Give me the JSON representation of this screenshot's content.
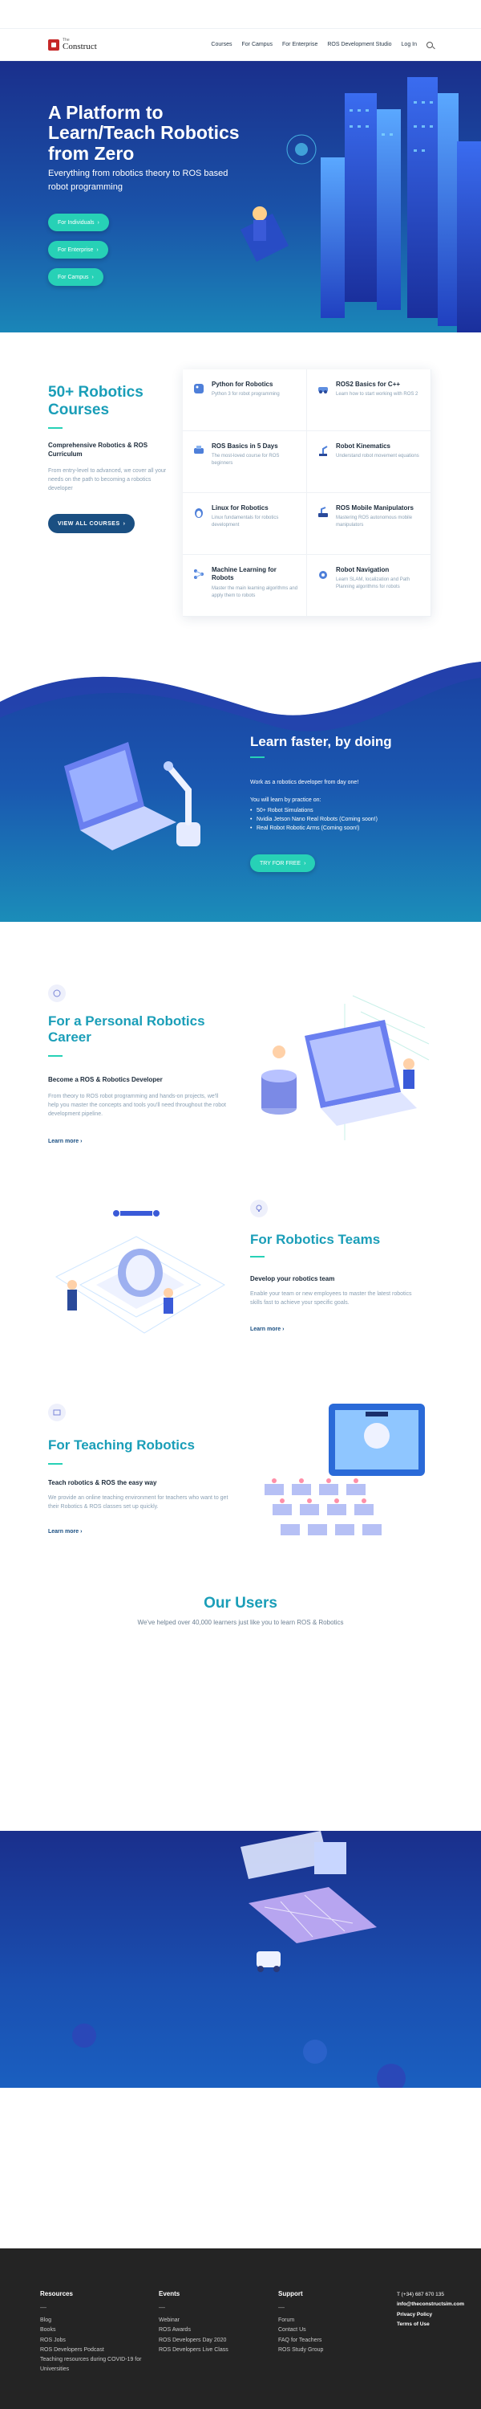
{
  "header": {
    "logo_small": "The",
    "logo_big": "Construct",
    "nav": [
      "Courses",
      "For Campus",
      "For Enterprise",
      "ROS Development Studio",
      "Log In"
    ]
  },
  "hero": {
    "title": "A Platform to Learn/Teach Robotics from Zero",
    "subtitle": "Everything from robotics theory to ROS based robot programming",
    "buttons": [
      "For Individuals",
      "For Enterprise",
      "For Campus"
    ]
  },
  "courses": {
    "title": "50+ Robotics Courses",
    "subtitle": "Comprehensive Robotics & ROS Curriculum",
    "description": "From entry-level to advanced, we cover all your needs on the path to becoming a robotics developer",
    "button": "VIEW ALL COURSES",
    "items": [
      {
        "name": "Python for Robotics",
        "desc": "Python 3 for robot programming"
      },
      {
        "name": "ROS2 Basics for C++",
        "desc": "Learn how to start working with ROS 2"
      },
      {
        "name": "ROS Basics in 5 Days",
        "desc": "The most-loved course for ROS beginners"
      },
      {
        "name": "Robot Kinematics",
        "desc": "Understand robot movement equations"
      },
      {
        "name": "Linux for Robotics",
        "desc": "Linux fundamentals for robotics development"
      },
      {
        "name": "ROS Mobile Manipulators",
        "desc": "Mastering ROS autonomous mobile manipulators"
      },
      {
        "name": "Machine Learning for Robots",
        "desc": "Master the main learning algorithms and apply them to robots"
      },
      {
        "name": "Robot Navigation",
        "desc": "Learn SLAM, localization and Path Planning algorithms for robots"
      }
    ]
  },
  "learn": {
    "title": "Learn faster, by doing",
    "line1": "Work as a robotics developer from day one!",
    "line2": "You will learn by practice on:",
    "bullets": [
      "50+ Robot Simulations",
      "Nvidia Jetson Nano Real Robots (Coming soon!)",
      "Real Robot Robotic Arms (Coming soon!)"
    ],
    "button": "TRY FOR FREE"
  },
  "personal": {
    "title": "For a Personal Robotics Career",
    "subtitle": "Become a ROS & Robotics Developer",
    "description": "From theory to ROS robot programming and hands-on projects, we'll help you master the concepts and tools you'll need throughout the robot development pipeline.",
    "link": "Learn more"
  },
  "teams": {
    "title": "For Robotics Teams",
    "subtitle": "Develop your robotics team",
    "description": "Enable your team or new employees to master the latest robotics skills fast to achieve your specific goals.",
    "link": "Learn more"
  },
  "teaching": {
    "title": "For Teaching Robotics",
    "subtitle": "Teach robotics & ROS the easy way",
    "description": "We provide an online teaching environment for teachers who want to get their Robotics & ROS classes set up quickly.",
    "link": "Learn more"
  },
  "users": {
    "title": "Our Users",
    "subtitle": "We've helped over 40,000 learners just like you to learn ROS & Robotics"
  },
  "footer": {
    "resources": {
      "title": "Resources",
      "dash": "—",
      "links": [
        "Blog",
        "Books",
        "ROS Jobs",
        "ROS Developers Podcast",
        "Teaching resources during COVID-19 for Universities"
      ]
    },
    "events": {
      "title": "Events",
      "dash": "—",
      "links": [
        "Webinar",
        "ROS Awards",
        "ROS Developers Day 2020",
        "ROS Developers Live Class"
      ]
    },
    "support": {
      "title": "Support",
      "dash": "—",
      "links": [
        "Forum",
        "Contact Us",
        "FAQ for Teachers",
        "ROS Study Group"
      ]
    },
    "contact": {
      "phone": "T (+34) 687 670 135",
      "email": "info@theconstructsim.com",
      "privacy": "Privacy Policy",
      "terms": "Terms of Use"
    }
  },
  "colors": {
    "accent": "#27d1b6",
    "title": "#1a9eb8",
    "navy": "#1a4f82",
    "hero_top": "#1a2f8c"
  }
}
